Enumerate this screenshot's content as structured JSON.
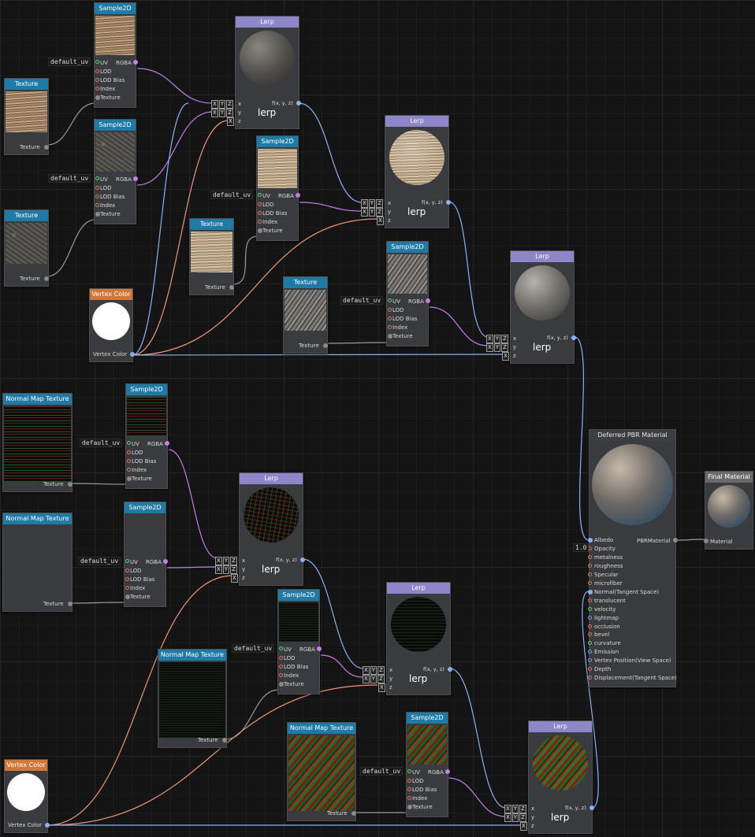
{
  "nodes": {
    "sample2d_title": "Sample2D",
    "texture_title": "Texture",
    "lerp_title": "Lerp",
    "vertex_color_title": "Vertex Color",
    "normal_map_title": "Normal Map Texture",
    "pbr_title": "Deferred PBR Material",
    "final_title": "Final Material"
  },
  "pins": {
    "uv": "UV",
    "rgba": "RGBA",
    "lod": "LOD",
    "lod_bias": "LOD Bias",
    "index": "Index",
    "texture": "Texture",
    "default_uv": "default_uv",
    "x": "x",
    "y": "y",
    "z": "z",
    "fxyz": "f(x, y, z)",
    "lerp_label": "lerp",
    "vertex_color": "Vertex Color",
    "xyz_x": "X",
    "xyz_y": "Y",
    "xyz_z": "Z",
    "pbr_material": "PBRMaterial",
    "material": "Material",
    "opacity_value": "1.0"
  },
  "pbr_inputs": [
    "Albedo",
    "Opacity",
    "metalness",
    "roughness",
    "Specular",
    "microfiber",
    "Normal(Tangent Space)",
    "translucent",
    "velocity",
    "lightmap",
    "occlusion",
    "bevel",
    "curvature",
    "Emission",
    "Vertex Position(View Space)",
    "Depth",
    "Displacement(Tangent Space)"
  ],
  "colors": {
    "header_teal": "#1f7aa6",
    "header_lavender": "#8e86c8",
    "header_orange": "#d2773a",
    "wire_purple": "#c57ee8",
    "wire_blue": "#8cb0f2",
    "wire_salmon": "#f0957a",
    "wire_grey": "#9a9a9a"
  }
}
